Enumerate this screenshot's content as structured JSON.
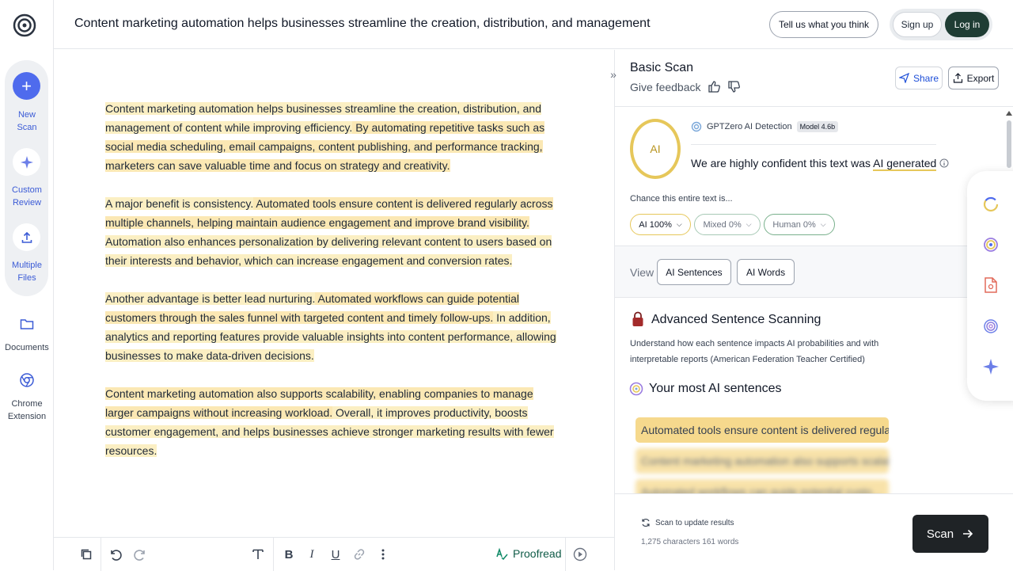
{
  "header": {
    "title": "Content marketing automation helps businesses streamline the creation, distribution, and management",
    "feedback_label": "Tell us what you think",
    "signup_label": "Sign up",
    "login_label": "Log in"
  },
  "sidebar": {
    "items": [
      {
        "label_1": "New",
        "label_2": "Scan",
        "icon": "plus-icon"
      },
      {
        "label_1": "Custom",
        "label_2": "Review",
        "icon": "sparkle-icon"
      },
      {
        "label_1": "Multiple",
        "label_2": "Files",
        "icon": "upload-icon"
      },
      {
        "label_1": "Documents",
        "label_2": "",
        "icon": "folder-icon"
      },
      {
        "label_1": "Chrome",
        "label_2": "Extension",
        "icon": "chrome-icon"
      }
    ]
  },
  "document": {
    "paragraphs": [
      {
        "s1": "Content marketing automation helps businesses streamline the creation, distribution, and management of content while improving efficiency.",
        "s2": " By automating repetitive tasks such as social media scheduling, email campaigns, content publishing, and performance tracking, marketers can save valuable time and focus on strategy and creativity."
      },
      {
        "s1": "A major benefit is consistency.",
        "s2": " Automated tools ensure content is delivered regularly across multiple channels, helping maintain audience engagement and improve brand visibility.",
        "s3": " Automation also enhances personalization by delivering relevant content to users based on their interests and behavior, which can increase engagement and conversion rates."
      },
      {
        "s1": "Another advantage is better lead nurturing.",
        "s2": " Automated workflows can guide potential customers through the sales funnel with targeted content and timely follow-ups.",
        "s3": " In addition, analytics and reporting features provide valuable insights into content performance, allowing businesses to make data-driven decisions."
      },
      {
        "s1": "Content marketing automation also supports scalability, enabling companies to manage larger campaigns without increasing workload.",
        "s2": " Overall, it improves productivity, boosts customer engagement, and helps businesses achieve stronger marketing results with fewer resources."
      }
    ]
  },
  "toolbar": {
    "proofread_label": "Proofread"
  },
  "panel": {
    "title": "Basic Scan",
    "give_feedback": "Give feedback",
    "share_label": "Share",
    "export_label": "Export",
    "ring_label": "AI",
    "detector_name": "GPTZero AI Detection",
    "model_badge": "Model 4.6b",
    "confidence_pre": "We are ",
    "confidence_strong": "highly confident",
    "confidence_mid": " this text was ",
    "confidence_ai": "AI generated",
    "chance_label": "Chance this entire text is...",
    "pills": {
      "ai": "AI 100%",
      "mixed": "Mixed 0%",
      "human": "Human 0%"
    },
    "view_label": "View",
    "view_sentences": "AI Sentences",
    "view_words": "AI Words",
    "advanced_title": "Advanced Sentence Scanning",
    "advanced_desc": "Understand how each sentence impacts AI probabilities and with interpretable reports (American Federation Teacher Certified)",
    "most_title": "Your most AI sentences",
    "sentences": [
      "Automated tools ensure content is delivered regula...",
      "Content marketing automation also supports scalab...",
      "Automated workflows can guide potential custo..."
    ],
    "status": "Scan to update results",
    "counts": "1,275 characters 161 words",
    "scan_label": "Scan"
  },
  "colors": {
    "accent": "#4f6bed",
    "ai_yellow": "#e6c75a",
    "highlight": "#fbefc3",
    "login_bg": "#1f3d34",
    "scan_bg": "#1f2326"
  }
}
